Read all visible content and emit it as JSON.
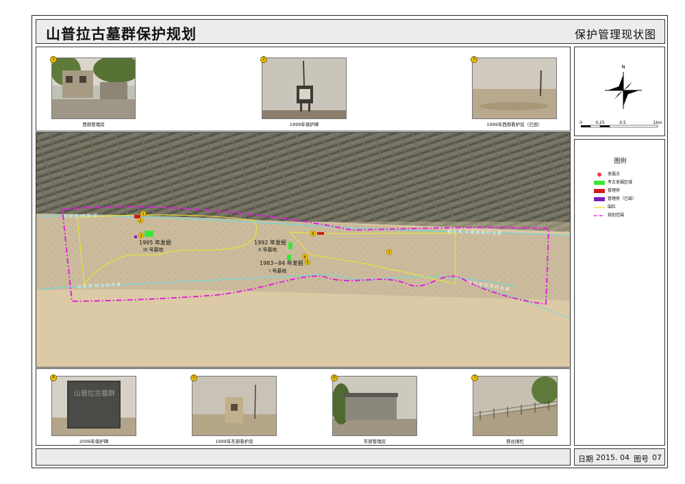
{
  "header": {
    "title": "山普拉古墓群保护规划",
    "subtitle": "保护管理现状图"
  },
  "photos_top": [
    {
      "number": "1",
      "caption": "西部管理房"
    },
    {
      "number": "2",
      "caption": "1999年保护碑"
    },
    {
      "number": "3",
      "caption": "1999年西部看护房（已毁）"
    }
  ],
  "photos_bottom": [
    {
      "number": "4",
      "caption": "2006年保护碑"
    },
    {
      "number": "5",
      "caption": "1999年东部看护房"
    },
    {
      "number": "6",
      "caption": "东部管理房"
    },
    {
      "number": "7",
      "caption": "铁丝围栏"
    }
  ],
  "stele_inscription": "山普拉古墓群",
  "compass": {
    "north": "N"
  },
  "scale": {
    "ticks": [
      "0",
      "0.25",
      "0.5",
      "1km"
    ]
  },
  "legend": {
    "title": "图例",
    "items": [
      {
        "label": "发掘点",
        "color": "#ff3b3b"
      },
      {
        "label": "考古发掘区域",
        "color": "#39e639"
      },
      {
        "label": "管理房",
        "color": "#d01c1c"
      },
      {
        "label": "管理房（已毁）",
        "color": "#7a1fb8"
      },
      {
        "label": "围栏",
        "color": "#e8e23a"
      },
      {
        "label": "规划范围",
        "color": "#e020d8"
      }
    ]
  },
  "map_labels": {
    "site_1995": [
      "1995 年发掘",
      "III 号墓地"
    ],
    "site_1992": [
      "1992 年发掘",
      "II 号墓地"
    ],
    "site_1983": [
      "1983~84 年发掘",
      "I 号墓地"
    ],
    "canal_north_left": "吐 拉 克 ·托 乌 ·达 ·",
    "canal_north_right": "都 拉 克 ·乌 格 里 格 村 水 渠",
    "canal_south_left": "吐 拉 克 ·托 乌 村 水 渠",
    "canal_south_right": "吐 拉 格 拉 克 村 水 渠",
    "markers": [
      "1",
      "2",
      "3",
      "4",
      "5",
      "6",
      "7"
    ]
  },
  "footer": {
    "date_label": "日期",
    "date": "2015. 04",
    "sheet_label": "图号",
    "sheet_no": "07"
  }
}
